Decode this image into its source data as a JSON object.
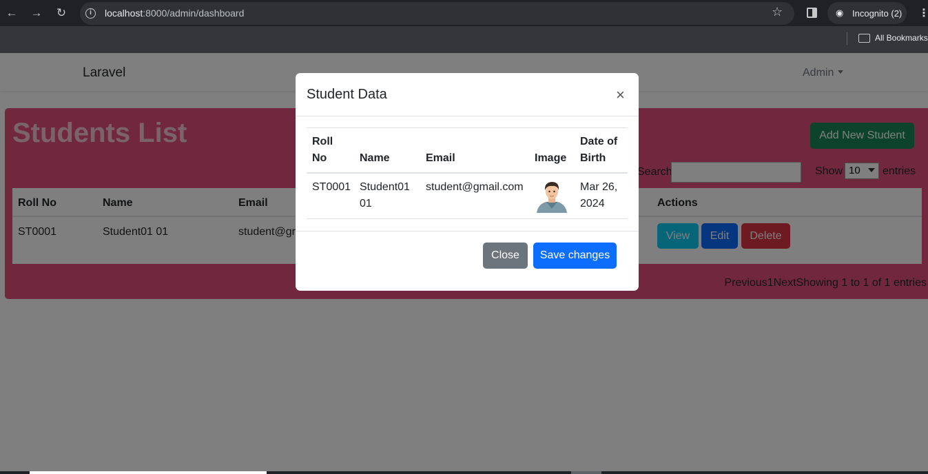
{
  "browser": {
    "url_host": "localhost",
    "url_rest": ":8000/admin/dashboard",
    "incognito_label": "Incognito (2)",
    "bookmarks_label": "All Bookmarks"
  },
  "navbar": {
    "brand": "Laravel",
    "user_menu": "Admin"
  },
  "card": {
    "title": "Students List",
    "add_button": "Add New Student",
    "search_label": "Search:",
    "show_label": "Show",
    "show_value": "10",
    "entries_label": "entries",
    "columns": [
      "Roll No",
      "Name",
      "Email",
      "Actions"
    ],
    "row": {
      "roll_no": "ST0001",
      "name": "Student01 01",
      "email": "student@gr"
    },
    "actions": [
      "View",
      "Edit",
      "Delete"
    ],
    "footer": "Previous1NextShowing 1 to 1 of 1 entries"
  },
  "modal": {
    "title": "Student Data",
    "close_glyph": "×",
    "columns": {
      "roll_no_1": "Roll",
      "roll_no_2": "No",
      "name": "Name",
      "email": "Email",
      "image": "Image",
      "dob_1": "Date of",
      "dob_2": "Birth"
    },
    "row": {
      "roll_no": "ST0001",
      "name_1": "Student01",
      "name_2": "01",
      "email": "student@gmail.com",
      "dob_1": "Mar 26,",
      "dob_2": "2024"
    },
    "close_button": "Close",
    "save_button": "Save changes"
  },
  "colors": {
    "card_bg": "#e2507f",
    "success": "#198754",
    "info": "#0dcaf0",
    "primary": "#0d6efd",
    "danger": "#dc3545",
    "secondary": "#6c757d"
  }
}
